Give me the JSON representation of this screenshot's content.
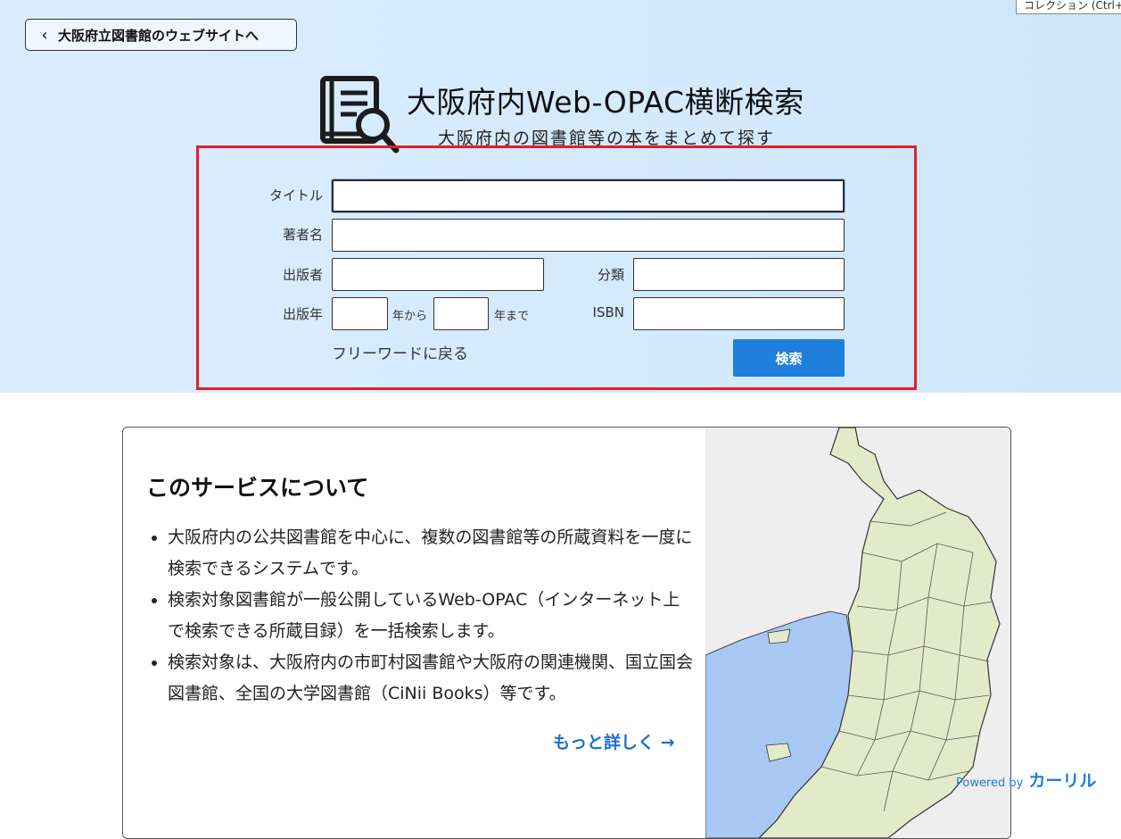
{
  "header": {
    "back_label": "大阪府立図書館のウェブサイトへ",
    "title": "大阪府内Web-OPAC横断検索",
    "subtitle": "大阪府内の図書館等の本をまとめて探す",
    "tooltip": "コレクション (Ctrl+"
  },
  "form": {
    "title_label": "タイトル",
    "title_value": "",
    "author_label": "著者名",
    "author_value": "",
    "publisher_label": "出版者",
    "publisher_value": "",
    "classification_label": "分類",
    "classification_value": "",
    "year_label": "出版年",
    "year_from_value": "",
    "year_from_suffix": "年から",
    "year_to_value": "",
    "year_to_suffix": "年まで",
    "isbn_label": "ISBN",
    "isbn_value": "",
    "freeword_link": "フリーワードに戻る",
    "search_button": "検索"
  },
  "about": {
    "heading": "このサービスについて",
    "items": [
      "大阪府内の公共図書館を中心に、複数の図書館等の所蔵資料を一度に検索できるシステムです。",
      "検索対象図書館が一般公開しているWeb-OPAC（インターネット上で検索できる所蔵目録）を一括検索します。",
      "検索対象は、大阪府内の市町村図書館や大阪府の関連機関、国立国会図書館、全国の大学図書館（CiNii Books）等です。"
    ],
    "more_link": "もっと詳しく →"
  },
  "footer": {
    "powered_by": "Powered by",
    "brand": "カーリル"
  },
  "colors": {
    "accent": "#1f7fdc",
    "highlight_frame": "#e0202c",
    "hero_bg": "#d6ebfd",
    "map_land": "#e3eac9",
    "map_water": "#a9c9f5"
  },
  "icons": {
    "back": "chevron-left-icon",
    "logo": "book-search-icon"
  }
}
